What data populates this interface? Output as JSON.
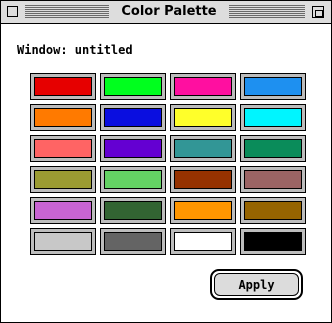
{
  "window": {
    "title": "Color Palette",
    "label": "Window: untitled"
  },
  "swatches": [
    {
      "color": "#e60000"
    },
    {
      "color": "#00ff1e"
    },
    {
      "color": "#ff0fa0"
    },
    {
      "color": "#1e90f0"
    },
    {
      "color": "#ff7a00"
    },
    {
      "color": "#0a0ee0"
    },
    {
      "color": "#ffff2a"
    },
    {
      "color": "#00f5ff"
    },
    {
      "color": "#ff6464"
    },
    {
      "color": "#6400d2"
    },
    {
      "color": "#329696"
    },
    {
      "color": "#0a8c5a"
    },
    {
      "color": "#9b9b32"
    },
    {
      "color": "#64d264"
    },
    {
      "color": "#963200"
    },
    {
      "color": "#9b6464"
    },
    {
      "color": "#c864d2"
    },
    {
      "color": "#326432"
    },
    {
      "color": "#ff9600"
    },
    {
      "color": "#966400"
    },
    {
      "color": "#c8c8c8"
    },
    {
      "color": "#646464"
    },
    {
      "color": "#ffffff"
    },
    {
      "color": "#000000"
    }
  ],
  "apply": {
    "label": "Apply"
  }
}
